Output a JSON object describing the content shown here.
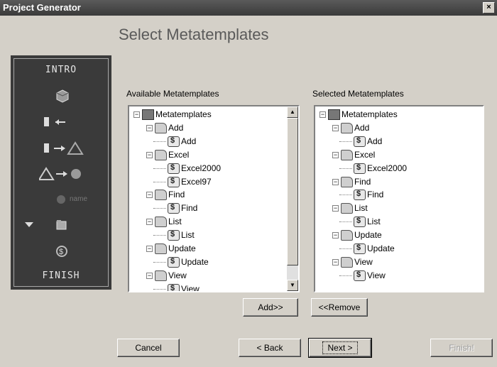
{
  "window": {
    "title": "Project Generator",
    "close_glyph": "×"
  },
  "heading": "Select Metatemplates",
  "steps": {
    "intro": "INTRO",
    "finish": "FINISH",
    "name_label": "name",
    "icons": [
      "cube-icon",
      "db-arrow-left-icon",
      "db-to-triangle-icon",
      "triangle-to-circle-icon",
      "circle-name-icon",
      "folder-icon",
      "sheet-icon"
    ]
  },
  "available": {
    "label": "Available Metatemplates",
    "tree": [
      {
        "label": "Metatemplates",
        "level": 0,
        "icon": "root",
        "toggle": "−"
      },
      {
        "label": "Add",
        "level": 1,
        "icon": "folder",
        "toggle": "−"
      },
      {
        "label": "Add",
        "level": 2,
        "icon": "sheet"
      },
      {
        "label": "Excel",
        "level": 1,
        "icon": "folder",
        "toggle": "−"
      },
      {
        "label": "Excel2000",
        "level": 2,
        "icon": "sheet"
      },
      {
        "label": "Excel97",
        "level": 2,
        "icon": "sheet"
      },
      {
        "label": "Find",
        "level": 1,
        "icon": "binoculars",
        "toggle": "−"
      },
      {
        "label": "Find",
        "level": 2,
        "icon": "sheet"
      },
      {
        "label": "List",
        "level": 1,
        "icon": "list",
        "toggle": "−"
      },
      {
        "label": "List",
        "level": 2,
        "icon": "sheet"
      },
      {
        "label": "Update",
        "level": 1,
        "icon": "folder",
        "toggle": "−"
      },
      {
        "label": "Update",
        "level": 2,
        "icon": "sheet"
      },
      {
        "label": "View",
        "level": 1,
        "icon": "eye",
        "toggle": "−"
      },
      {
        "label": "View",
        "level": 2,
        "icon": "sheet"
      }
    ]
  },
  "selected": {
    "label": "Selected Metatemplates",
    "tree": [
      {
        "label": "Metatemplates",
        "level": 0,
        "icon": "root",
        "toggle": "−"
      },
      {
        "label": "Add",
        "level": 1,
        "icon": "folder",
        "toggle": "−"
      },
      {
        "label": "Add",
        "level": 2,
        "icon": "sheet"
      },
      {
        "label": "Excel",
        "level": 1,
        "icon": "folder",
        "toggle": "−"
      },
      {
        "label": "Excel2000",
        "level": 2,
        "icon": "sheet"
      },
      {
        "label": "Find",
        "level": 1,
        "icon": "binoculars",
        "toggle": "−"
      },
      {
        "label": "Find",
        "level": 2,
        "icon": "sheet"
      },
      {
        "label": "List",
        "level": 1,
        "icon": "list",
        "toggle": "−"
      },
      {
        "label": "List",
        "level": 2,
        "icon": "sheet"
      },
      {
        "label": "Update",
        "level": 1,
        "icon": "folder",
        "toggle": "−"
      },
      {
        "label": "Update",
        "level": 2,
        "icon": "sheet"
      },
      {
        "label": "View",
        "level": 1,
        "icon": "eye",
        "toggle": "−"
      },
      {
        "label": "View",
        "level": 2,
        "icon": "sheet"
      }
    ]
  },
  "buttons": {
    "add": "Add>>",
    "remove": "<<Remove",
    "cancel": "Cancel",
    "back": "< Back",
    "next": "Next >",
    "finish": "Finish!"
  },
  "scroll_arrows": {
    "up": "▲",
    "down": "▼"
  }
}
